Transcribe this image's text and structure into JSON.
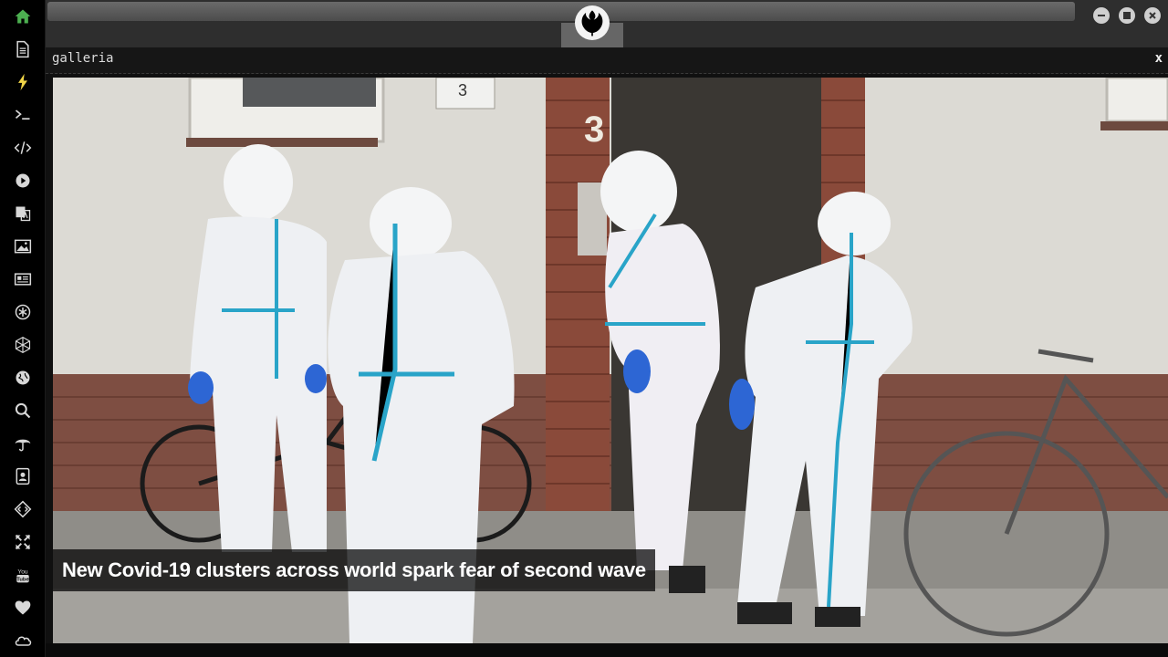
{
  "sidebar": {
    "items": [
      {
        "icon": "home-icon",
        "color": "#4caf50"
      },
      {
        "icon": "document-icon",
        "color": "#d8d8d8"
      },
      {
        "icon": "lightning-icon",
        "color": "#f2d648"
      },
      {
        "icon": "terminal-icon",
        "color": "#d8d8d8"
      },
      {
        "icon": "code-icon",
        "color": "#d8d8d8"
      },
      {
        "icon": "play-icon",
        "color": "#d8d8d8"
      },
      {
        "icon": "translate-icon",
        "color": "#d8d8d8"
      },
      {
        "icon": "image-icon",
        "color": "#d8d8d8"
      },
      {
        "icon": "news-icon",
        "color": "#d8d8d8"
      },
      {
        "icon": "asterisk-icon",
        "color": "#d8d8d8"
      },
      {
        "icon": "polyhedron-icon",
        "color": "#d8d8d8"
      },
      {
        "icon": "globe-icon",
        "color": "#d8d8d8"
      },
      {
        "icon": "search-icon",
        "color": "#d8d8d8"
      },
      {
        "icon": "umbrella-icon",
        "color": "#d8d8d8"
      },
      {
        "icon": "contact-card-icon",
        "color": "#d8d8d8"
      },
      {
        "icon": "code-diamond-icon",
        "color": "#d8d8d8"
      },
      {
        "icon": "expand-icon",
        "color": "#d8d8d8"
      },
      {
        "icon": "youtube-icon",
        "color": "#d8d8d8"
      },
      {
        "icon": "heart-icon",
        "color": "#d8d8d8"
      },
      {
        "icon": "cloud-icon",
        "color": "#d8d8d8"
      }
    ]
  },
  "window": {
    "logo": "rebel-alliance-icon",
    "controls": [
      "minimize-icon",
      "maximize-icon",
      "close-icon"
    ]
  },
  "panel": {
    "title": "galleria",
    "close_label": "x"
  },
  "gallery": {
    "caption": "New Covid-19 clusters across world spark fear of second wave"
  }
}
